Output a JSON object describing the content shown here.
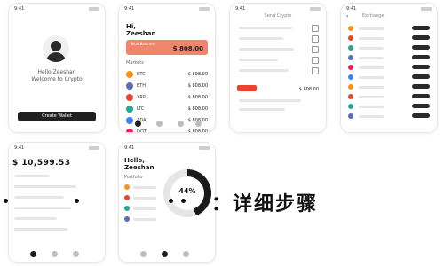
{
  "screens": {
    "welcome": {
      "time": "9:41",
      "line1": "Hello Zeeshan",
      "line2": "Welcome to Crypto",
      "button": "Create Wallet"
    },
    "home": {
      "time": "9:41",
      "greeting_line1": "Hi,",
      "greeting_line2": "Zeeshan",
      "card_label": "Total Balance",
      "card_amount": "$ 808.00",
      "section": "Markets",
      "assets": [
        {
          "name": "BTC",
          "value": "$ 808.00",
          "color": "#f7931a"
        },
        {
          "name": "ETH",
          "value": "$ 808.00",
          "color": "#5c6bc0"
        },
        {
          "name": "XRP",
          "value": "$ 808.00",
          "color": "#e8452c"
        },
        {
          "name": "LTC",
          "value": "$ 808.00",
          "color": "#26a69a"
        },
        {
          "name": "ADA",
          "value": "$ 808.00",
          "color": "#3b82f6"
        },
        {
          "name": "DOT",
          "value": "$ 808.00",
          "color": "#e91e63"
        }
      ]
    },
    "transfer": {
      "time": "9:41",
      "title": "Send Crypto",
      "amount": "$ 808.00"
    },
    "exchange": {
      "time": "9:41",
      "title": "Exchange",
      "icon_colors": [
        "#f7931a",
        "#e8452c",
        "#26a69a",
        "#5c6bc0",
        "#e91e63",
        "#3b82f6",
        "#f7931a",
        "#e8452c",
        "#26a69a",
        "#5c6bc0"
      ]
    },
    "wallet": {
      "time": "9:41",
      "balance": "$ 10,599.53"
    },
    "portfolio": {
      "time": "9:41",
      "greeting_line1": "Hello,",
      "greeting_line2": "Zeeshan",
      "section": "Portfolio",
      "percent": "44%",
      "percent_value": 44
    }
  },
  "headline": "：详细步骤"
}
